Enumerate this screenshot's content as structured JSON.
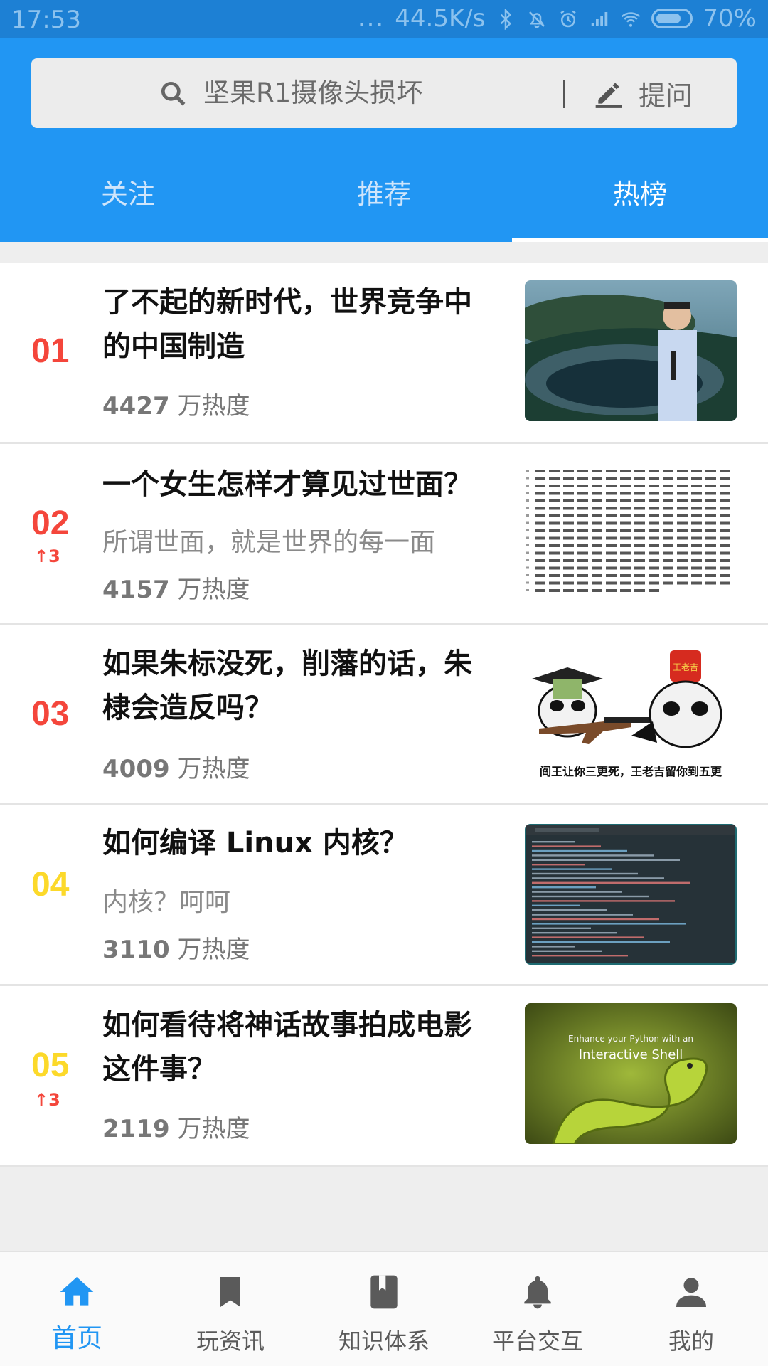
{
  "status_bar": {
    "time": "17:53",
    "dots": "...",
    "net_speed": "44.5K/s",
    "battery": "70%"
  },
  "search": {
    "text": "坚果R1摄像头损坏",
    "ask_label": "提问"
  },
  "tabs": [
    {
      "label": "关注",
      "active": false
    },
    {
      "label": "推荐",
      "active": false
    },
    {
      "label": "热榜",
      "active": true
    }
  ],
  "colors": {
    "primary": "#2196f3",
    "status_bar": "#1d80d4",
    "rank_red": "#f4463b",
    "rank_yellow": "#fcd92a"
  },
  "hot_list": [
    {
      "rank": "01",
      "title_lines": [
        "了不起的新时代，世界竞争中",
        "的中国制造"
      ],
      "trend": "",
      "excerpt": "",
      "heat_num": "4427",
      "heat_unit": "万热度",
      "thumb": "speaker-stage-photo"
    },
    {
      "rank": "02",
      "title_lines": [
        "一个女生怎样才算见过世面？"
      ],
      "trend": "↑3",
      "excerpt": "所谓世面，就是世界的每一面",
      "heat_num": "4157",
      "heat_unit": "万热度",
      "thumb": "code-text-image"
    },
    {
      "rank": "03",
      "title_lines": [
        "如果朱标没死，削藩的话，朱",
        "棣会造反吗？"
      ],
      "trend": "",
      "excerpt": "",
      "heat_num": "4009",
      "heat_unit": "万热度",
      "thumb": "panda-meme",
      "thumb_caption": "阎王让你三更死，王老吉留你到五更",
      "thumb_can_text": "王老吉"
    },
    {
      "rank": "04",
      "title_lines": [
        "如何编译 Linux 内核？"
      ],
      "trend": "",
      "excerpt": "内核？呵呵",
      "heat_num": "3110",
      "heat_unit": "万热度",
      "thumb": "terminal-screenshot"
    },
    {
      "rank": "05",
      "title_lines": [
        "如何看待将神话故事拍成电影",
        "这件事？"
      ],
      "trend": "↑3",
      "excerpt": "",
      "heat_num": "2119",
      "heat_unit": "万热度",
      "thumb": "python-snake-poster",
      "thumb_caption_lines": [
        "Enhance your Python with an",
        "Interactive Shell"
      ]
    }
  ],
  "bottom_nav": [
    {
      "label": "首页",
      "icon": "home-icon",
      "active": true
    },
    {
      "label": "玩资讯",
      "icon": "bookmark-icon",
      "active": false
    },
    {
      "label": "知识体系",
      "icon": "book-icon",
      "active": false
    },
    {
      "label": "平台交互",
      "icon": "bell-icon",
      "active": false
    },
    {
      "label": "我的",
      "icon": "person-icon",
      "active": false
    }
  ]
}
